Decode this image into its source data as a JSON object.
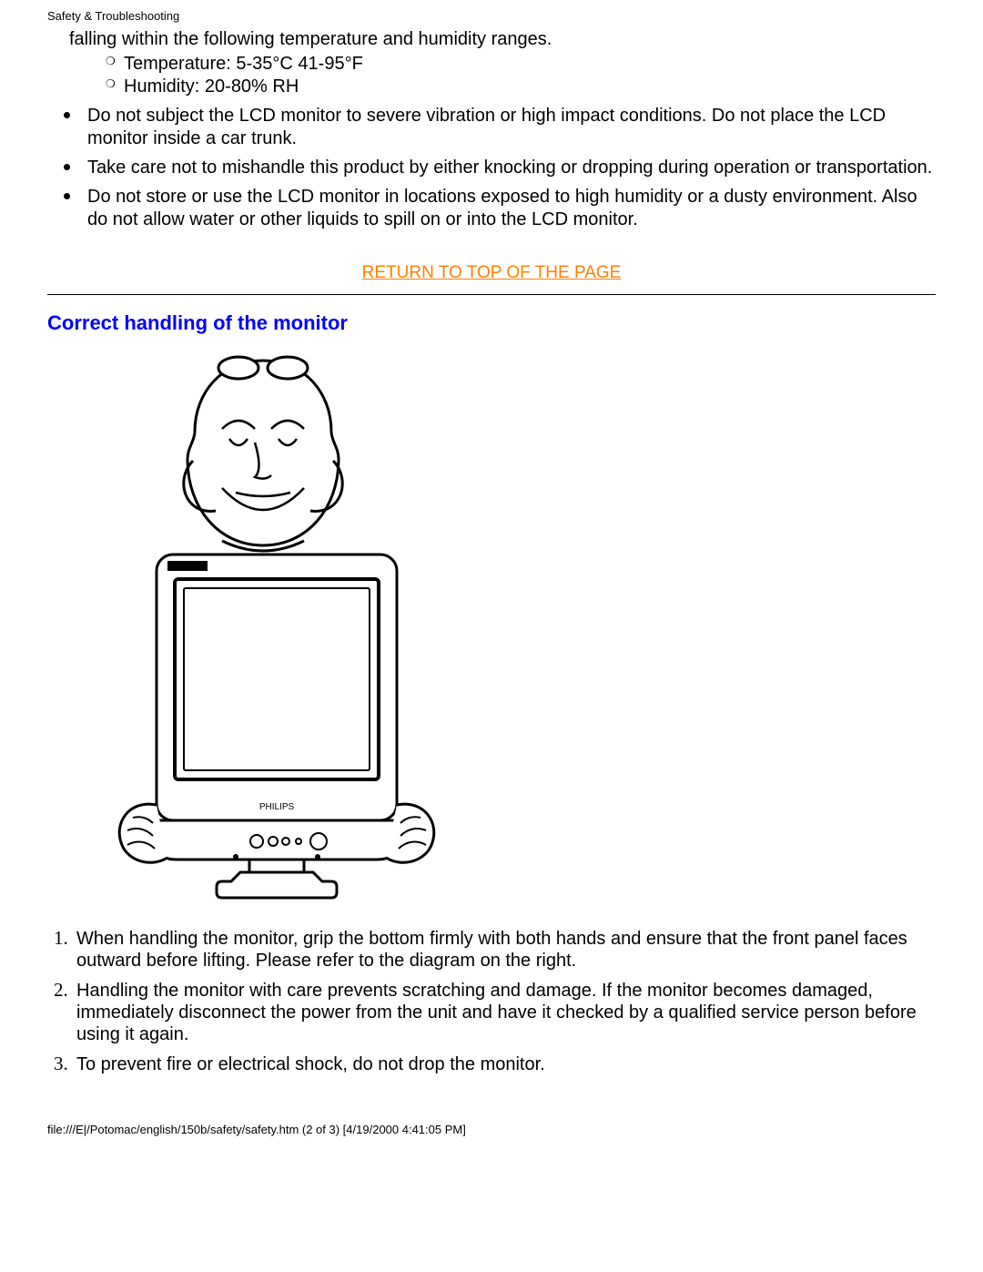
{
  "header": "Safety & Troubleshooting",
  "intro_fragment": "falling within the following temperature and humidity ranges.",
  "sub_bullets": [
    "Temperature: 5-35°C 41-95°F",
    "Humidity: 20-80% RH"
  ],
  "main_bullets": [
    "Do not subject the LCD monitor to severe vibration or high impact conditions. Do not place the LCD monitor inside a car trunk.",
    "Take care not to mishandle this product by either knocking or dropping during operation or transportation.",
    "Do not store or use the LCD monitor in locations exposed to high humidity or a dusty environment. Also do not allow water or other liquids to spill on or into the LCD monitor."
  ],
  "return_link_text": "RETURN TO TOP OF THE PAGE",
  "section_title": "Correct handling of the monitor",
  "numbered": [
    "When handling the monitor, grip the bottom firmly with both hands and ensure that the front panel faces outward before lifting. Please refer to the diagram on the right.",
    "Handling the monitor with care prevents scratching and damage. If the monitor becomes damaged, immediately disconnect the power from the unit and have it checked by a qualified service person before using it again.",
    "To prevent fire or electrical shock, do not drop the monitor."
  ],
  "footer": "file:///E|/Potomac/english/150b/safety/safety.htm (2 of 3) [4/19/2000 4:41:05 PM]"
}
